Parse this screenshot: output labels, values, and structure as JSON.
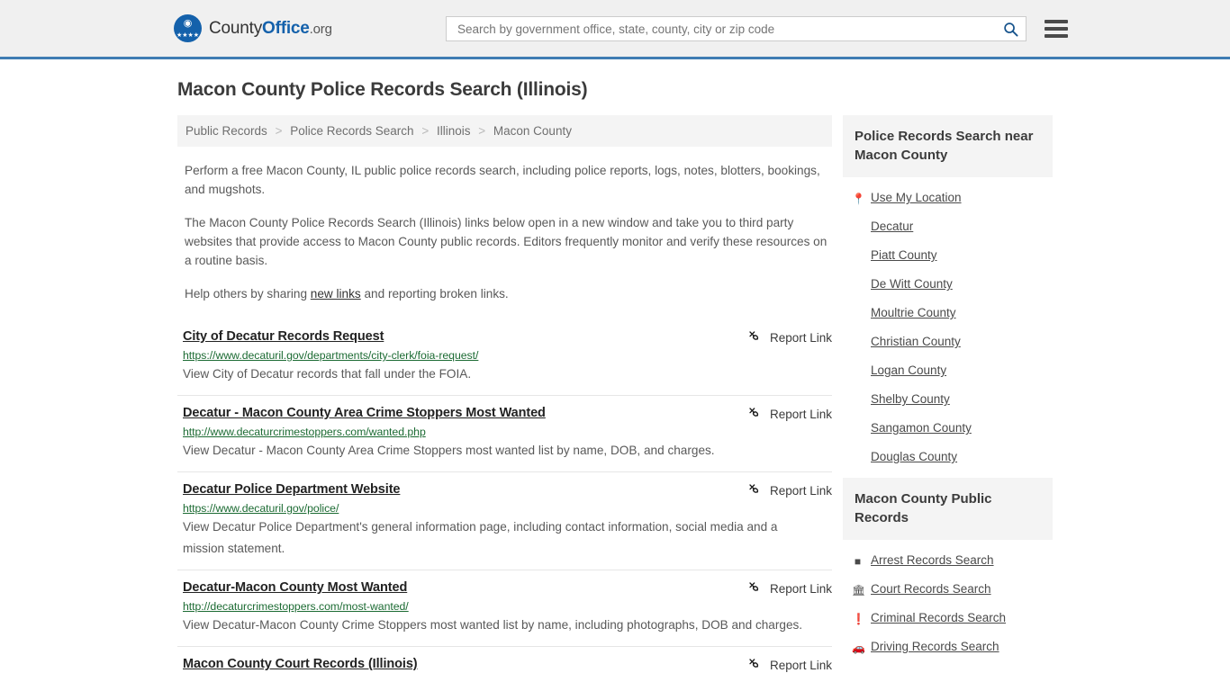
{
  "header": {
    "logo": {
      "name_part1": "County",
      "name_part2": "Office",
      "name_suffix": ".org",
      "icon": "eagle-shield-logo",
      "brand_color": "#1461ab"
    },
    "search": {
      "placeholder": "Search by government office, state, county, city or zip code",
      "value": "",
      "icon": "search-icon"
    },
    "menu_icon": "hamburger-menu-icon"
  },
  "page_title": "Macon County Police Records Search (Illinois)",
  "breadcrumb": {
    "separator": ">",
    "items": [
      {
        "label": "Public Records"
      },
      {
        "label": "Police Records Search"
      },
      {
        "label": "Illinois"
      },
      {
        "label": "Macon County"
      }
    ]
  },
  "intro": {
    "p1": "Perform a free Macon County, IL public police records search, including police reports, logs, notes, blotters, bookings, and mugshots.",
    "p2": "The Macon County Police Records Search (Illinois) links below open in a new window and take you to third party websites that provide access to Macon County public records. Editors frequently monitor and verify these resources on a routine basis.",
    "p3_before": "Help others by sharing ",
    "p3_link": "new links",
    "p3_after": " and reporting broken links."
  },
  "results": {
    "report_link_label": "Report Link",
    "report_link_icon": "broken-chain-icon",
    "items": [
      {
        "title": "City of Decatur Records Request",
        "url": "https://www.decaturil.gov/departments/city-clerk/foia-request/",
        "description": "View City of Decatur records that fall under the FOIA."
      },
      {
        "title": "Decatur - Macon County Area Crime Stoppers Most Wanted",
        "url": "http://www.decaturcrimestoppers.com/wanted.php",
        "description": "View Decatur - Macon County Area Crime Stoppers most wanted list by name, DOB, and charges."
      },
      {
        "title": "Decatur Police Department Website",
        "url": "https://www.decaturil.gov/police/",
        "description": "View Decatur Police Department's general information page, including contact information, social media and a mission statement."
      },
      {
        "title": "Decatur-Macon County Most Wanted",
        "url": "http://decaturcrimestoppers.com/most-wanted/",
        "description": "View Decatur-Macon County Crime Stoppers most wanted list by name, including photographs, DOB and charges."
      },
      {
        "title": "Macon County Court Records (Illinois)",
        "url": "",
        "description": ""
      }
    ]
  },
  "sidebar": {
    "nearby": {
      "heading": "Police Records Search near Macon County",
      "items": [
        {
          "label": "Use My Location",
          "icon": "map-pin-icon"
        },
        {
          "label": "Decatur",
          "icon": ""
        },
        {
          "label": "Piatt County",
          "icon": ""
        },
        {
          "label": "De Witt County",
          "icon": ""
        },
        {
          "label": "Moultrie County",
          "icon": ""
        },
        {
          "label": "Christian County",
          "icon": ""
        },
        {
          "label": "Logan County",
          "icon": ""
        },
        {
          "label": "Shelby County",
          "icon": ""
        },
        {
          "label": "Sangamon County",
          "icon": ""
        },
        {
          "label": "Douglas County",
          "icon": ""
        }
      ]
    },
    "public_records": {
      "heading": "Macon County Public Records",
      "items": [
        {
          "label": "Arrest Records Search",
          "icon": "fingerprint-square-icon"
        },
        {
          "label": "Court Records Search",
          "icon": "courthouse-icon"
        },
        {
          "label": "Criminal Records Search",
          "icon": "exclamation-icon"
        },
        {
          "label": "Driving Records Search",
          "icon": "car-icon"
        }
      ]
    }
  }
}
